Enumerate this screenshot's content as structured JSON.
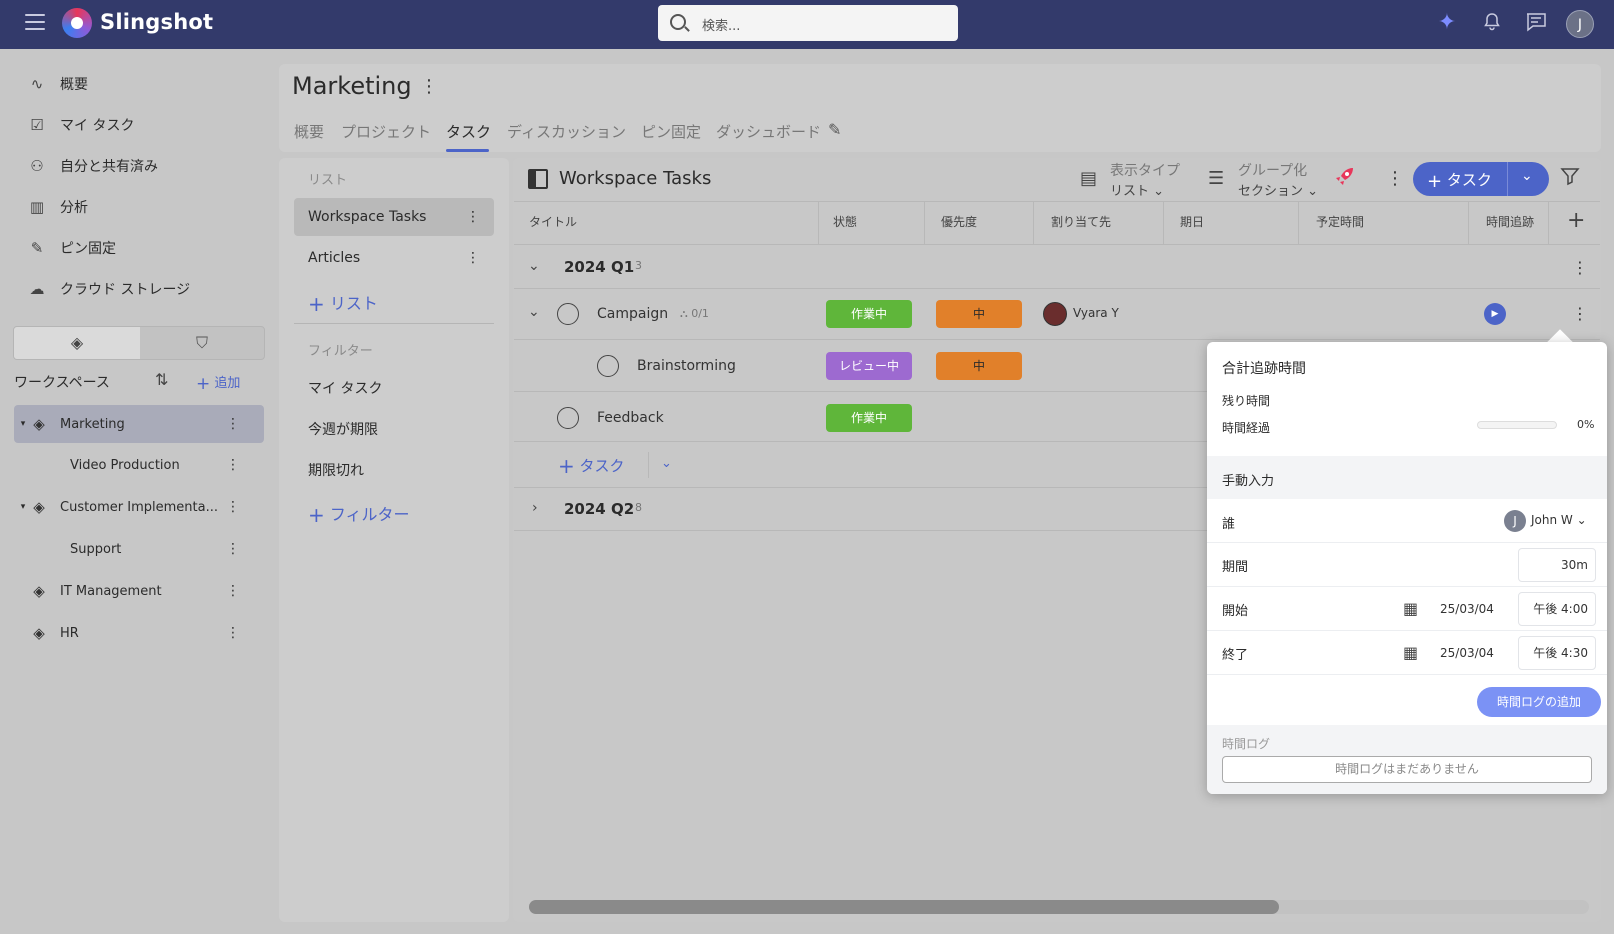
{
  "app": {
    "name": "Slingshot",
    "search_placeholder": "検索...",
    "user_initial": "J"
  },
  "nav": {
    "items": [
      "概要",
      "マイ タスク",
      "自分と共有済み",
      "分析",
      "ピン固定",
      "クラウド ストレージ"
    ]
  },
  "workspaces": {
    "heading": "ワークスペース",
    "add_label": "追加",
    "items": [
      "Marketing",
      "Video Production",
      "Customer Implementa...",
      "Support",
      "IT Management",
      "HR"
    ]
  },
  "project": {
    "title": "Marketing",
    "tabs": [
      "概要",
      "プロジェクト",
      "タスク",
      "ディスカッション",
      "ピン固定",
      "ダッシュボード"
    ],
    "active_tab": "タスク"
  },
  "lists": {
    "heading": "リスト",
    "items": [
      "Workspace Tasks",
      "Articles"
    ],
    "add_label": "リスト",
    "filter_heading": "フィルター",
    "filters": [
      "マイ タスク",
      "今週が期限",
      "期限切れ"
    ],
    "add_filter_label": "フィルター"
  },
  "tasks": {
    "title": "Workspace Tasks",
    "view_type": {
      "label": "表示タイプ",
      "value": "リスト"
    },
    "grouping": {
      "label": "グループ化",
      "value": "セクション"
    },
    "add_button": "タスク",
    "columns": [
      "タイトル",
      "状態",
      "優先度",
      "割り当て先",
      "期日",
      "予定時間",
      "時間追跡"
    ],
    "groups": [
      {
        "label": "2024 Q1",
        "count": "3"
      },
      {
        "label": "2024 Q2",
        "count": "8"
      }
    ],
    "rows": [
      {
        "name": "Campaign",
        "subtasks": "0/1",
        "status": "作業中",
        "priority": "中",
        "assignee": "Vyara Y"
      },
      {
        "name": "Brainstorming",
        "status": "レビュー中",
        "priority": "中"
      },
      {
        "name": "Feedback",
        "status": "作業中"
      }
    ],
    "add_inline": "タスク"
  },
  "popover": {
    "title": "合計追跡時間",
    "remaining_label": "残り時間",
    "elapsed_label": "時間経過",
    "elapsed_fraction": 0,
    "elapsed_pct": "0%",
    "manual_label": "手動入力",
    "who_label": "誰",
    "who_value": "John W",
    "who_initial": "J",
    "duration_label": "期間",
    "duration_value": "30m",
    "start_label": "開始",
    "start_date": "25/03/04",
    "start_time": "午後 4:00",
    "end_label": "終了",
    "end_date": "25/03/04",
    "end_time": "午後 4:30",
    "add_log_button": "時間ログの追加",
    "log_label": "時間ログ",
    "log_empty": "時間ログはまだありません"
  },
  "colors": {
    "topbar": "#333a6b",
    "accent": "#4c64c8",
    "in_progress": "#5fb63a",
    "review": "#9d6ad0",
    "priority_medium": "#e1802a"
  }
}
